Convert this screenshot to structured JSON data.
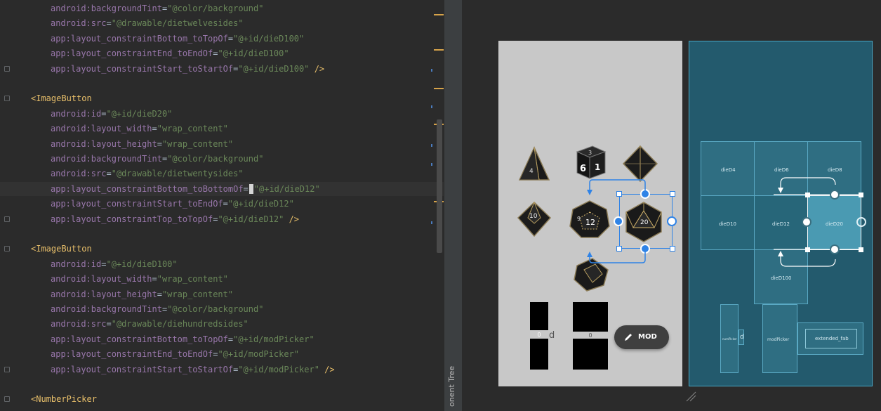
{
  "editor": {
    "lines": [
      {
        "kind": "attr",
        "ns": "android:",
        "name": "backgroundTint",
        "value": "\"@color/background\""
      },
      {
        "kind": "attr",
        "ns": "android:",
        "name": "src",
        "value": "\"@drawable/dietwelvesides\""
      },
      {
        "kind": "attr",
        "ns": "app:",
        "name": "layout_constraintBottom_toTopOf",
        "value": "\"@+id/dieD100\""
      },
      {
        "kind": "attr",
        "ns": "app:",
        "name": "layout_constraintEnd_toEndOf",
        "value": "\"@+id/dieD100\""
      },
      {
        "kind": "attr-close",
        "ns": "app:",
        "name": "layout_constraintStart_toStartOf",
        "value": "\"@+id/dieD100\"",
        "close": " />"
      },
      {
        "kind": "blank"
      },
      {
        "kind": "tag",
        "text": "<ImageButton"
      },
      {
        "kind": "attr",
        "ns": "android:",
        "name": "id",
        "value": "\"@+id/dieD20\""
      },
      {
        "kind": "attr",
        "ns": "android:",
        "name": "layout_width",
        "value": "\"wrap_content\""
      },
      {
        "kind": "attr",
        "ns": "android:",
        "name": "layout_height",
        "value": "\"wrap_content\""
      },
      {
        "kind": "attr",
        "ns": "android:",
        "name": "backgroundTint",
        "value": "\"@color/background\""
      },
      {
        "kind": "attr",
        "ns": "android:",
        "name": "src",
        "value": "\"@drawable/dietwentysides\""
      },
      {
        "kind": "attr-caret",
        "ns": "app:",
        "name": "layout_constraintBottom_toBottomOf",
        "value": "\"@+id/dieD12\""
      },
      {
        "kind": "attr",
        "ns": "app:",
        "name": "layout_constraintStart_toEndOf",
        "value": "\"@+id/dieD12\""
      },
      {
        "kind": "attr-close",
        "ns": "app:",
        "name": "layout_constraintTop_toTopOf",
        "value": "\"@+id/dieD12\"",
        "close": " />"
      },
      {
        "kind": "blank"
      },
      {
        "kind": "tag",
        "text": "<ImageButton"
      },
      {
        "kind": "attr",
        "ns": "android:",
        "name": "id",
        "value": "\"@+id/dieD100\""
      },
      {
        "kind": "attr",
        "ns": "android:",
        "name": "layout_width",
        "value": "\"wrap_content\""
      },
      {
        "kind": "attr",
        "ns": "android:",
        "name": "layout_height",
        "value": "\"wrap_content\""
      },
      {
        "kind": "attr",
        "ns": "android:",
        "name": "backgroundTint",
        "value": "\"@color/background\""
      },
      {
        "kind": "attr",
        "ns": "android:",
        "name": "src",
        "value": "\"@drawable/diehundredsides\""
      },
      {
        "kind": "attr",
        "ns": "app:",
        "name": "layout_constraintBottom_toTopOf",
        "value": "\"@+id/modPicker\""
      },
      {
        "kind": "attr",
        "ns": "app:",
        "name": "layout_constraintEnd_toEndOf",
        "value": "\"@+id/modPicker\""
      },
      {
        "kind": "attr-close",
        "ns": "app:",
        "name": "layout_constraintStart_toStartOf",
        "value": "\"@+id/modPicker\"",
        "close": " />"
      },
      {
        "kind": "blank"
      },
      {
        "kind": "tag",
        "text": "<NumberPicker"
      }
    ]
  },
  "side_panel": {
    "label": "onent Tree"
  },
  "design": {
    "dice_faces": [
      "4",
      "3",
      "6",
      "1",
      "10",
      "9",
      "12",
      "20"
    ],
    "picker_left_value": "0",
    "picker_right_value": "0",
    "d_separator": "d",
    "fab_label": "MOD"
  },
  "blueprint": {
    "cells": {
      "d4": "dieD4",
      "d6": "dieD6",
      "d8": "dieD8",
      "d10": "dieD10",
      "d12": "dieD12",
      "d20": "dieD20",
      "d100": "dieD100",
      "num_picker": "numPicker",
      "d": "d",
      "mod_picker": "modPicker",
      "extended_fab": "extended_fab"
    }
  },
  "colors": {
    "editor_bg": "#2b2b2b",
    "attr": "#9876aa",
    "string": "#6a8759",
    "tag": "#e8bf6a",
    "selection_blue": "#2f83e6",
    "blueprint_bg": "#235a6d"
  }
}
